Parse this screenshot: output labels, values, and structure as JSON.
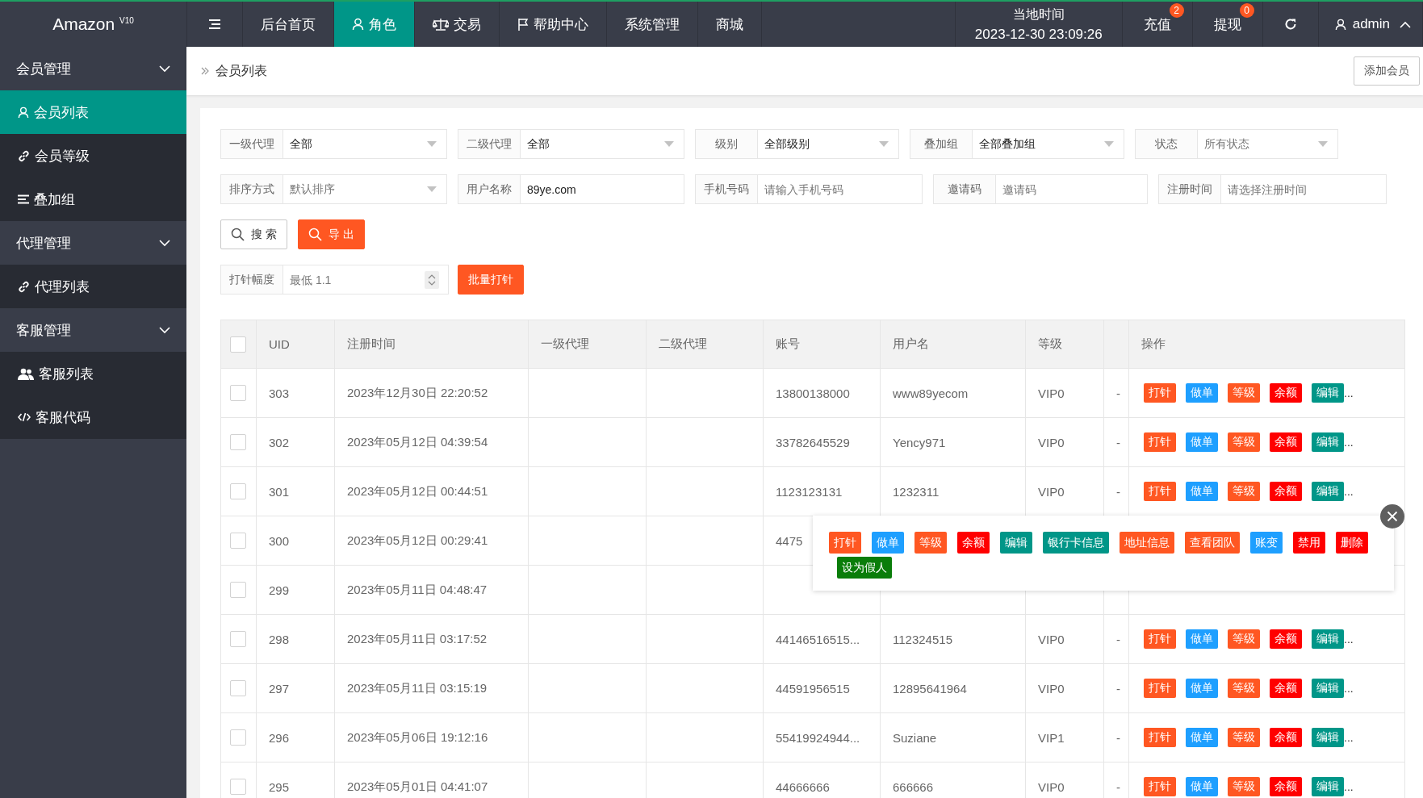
{
  "header": {
    "logo": "Amazon $^{V10}$",
    "nav": [
      {
        "label": "后台首页",
        "selected": false
      },
      {
        "label": "角色",
        "selected": true
      },
      {
        "label": "交易",
        "selected": false
      },
      {
        "label": "帮助中心",
        "selected": false
      },
      {
        "label": "系统管理",
        "selected": false
      },
      {
        "label": "商城",
        "selected": false
      }
    ],
    "clock": {
      "label": "当地时间",
      "value": "2023-12-30 23:09:26"
    },
    "quick": [
      {
        "label": "充值",
        "badge": "2"
      },
      {
        "label": "提现",
        "badge": "0"
      }
    ],
    "user": "admin"
  },
  "sidebar": [
    {
      "label": "会员管理",
      "expanded": true,
      "children": [
        {
          "label": "会员列表",
          "selected": true
        },
        {
          "label": "会员等级",
          "selected": false
        },
        {
          "label": "叠加组",
          "selected": false
        }
      ]
    },
    {
      "label": "代理管理",
      "expanded": true,
      "children": [
        {
          "label": "代理列表",
          "selected": false
        }
      ]
    },
    {
      "label": "客服管理",
      "expanded": true,
      "children": [
        {
          "label": "客服列表",
          "selected": false
        },
        {
          "label": "客服代码",
          "selected": false
        }
      ]
    }
  ],
  "breadcrumb": {
    "current": "会员列表",
    "add_button": "添加会员"
  },
  "filters": [
    [
      {
        "kind": "select",
        "label": "一级代理",
        "value": "全部"
      },
      {
        "kind": "select",
        "label": "二级代理",
        "value": "全部"
      },
      {
        "kind": "select",
        "label": "级别",
        "value": "全部级别"
      },
      {
        "kind": "select",
        "label": "叠加组",
        "value": "全部叠加组"
      },
      {
        "kind": "select",
        "label": "状态",
        "placeholder": "所有状态"
      }
    ],
    [
      {
        "kind": "select",
        "label": "排序方式",
        "placeholder": "默认排序"
      },
      {
        "kind": "text",
        "label": "用户名称",
        "value": "89ye.com"
      },
      {
        "kind": "text",
        "label": "手机号码",
        "placeholder": "请输入手机号码"
      },
      {
        "kind": "text",
        "label": "邀请码",
        "placeholder": "邀请码"
      },
      {
        "kind": "text",
        "label": "注册时间",
        "placeholder": "请选择注册时间"
      }
    ]
  ],
  "buttons": [
    {
      "label": "搜 索",
      "kind": "outline"
    },
    {
      "label": "导 出",
      "kind": "primary"
    }
  ],
  "dosage": {
    "label": "打针幅度",
    "placeholder": "最低 1.1",
    "button": "批量打针"
  },
  "table": {
    "all_checked": false,
    "columns": [
      {
        "label": "UID"
      },
      {
        "label": "注册时间"
      },
      {
        "label": "一级代理"
      },
      {
        "label": "二级代理"
      },
      {
        "label": "账号"
      },
      {
        "label": "用户名"
      },
      {
        "label": "等级"
      },
      {},
      {
        "label": "操作"
      }
    ],
    "rows": [
      {
        "checked": false,
        "uid": "303",
        "registered": "2023年12月30日 22:20:52",
        "account": "13800138000",
        "username": "www89yecom",
        "level": "VIP0",
        "column_9": "-",
        "actions": [
          {
            "label": "打针",
            "color": "#ff5722"
          },
          {
            "label": "做单",
            "color": "#1e9fff"
          },
          {
            "label": "等级",
            "color": "#ff5722"
          },
          {
            "label": "余额",
            "color": "#ff0000"
          },
          {
            "label": "编辑",
            "color": "#009688"
          }
        ],
        "more": "..."
      },
      {
        "checked": false,
        "uid": "302",
        "registered": "2023年05月12日 04:39:54",
        "account": "33782645529",
        "username": "Yency971",
        "level": "VIP0",
        "column_9": "-",
        "actions": [
          {
            "label": "打针",
            "color": "#ff5722"
          },
          {
            "label": "做单",
            "color": "#1e9fff"
          },
          {
            "label": "等级",
            "color": "#ff5722"
          },
          {
            "label": "余额",
            "color": "#ff0000"
          },
          {
            "label": "编辑",
            "color": "#009688"
          }
        ],
        "more": "..."
      },
      {
        "checked": false,
        "uid": "301",
        "registered": "2023年05月12日 00:44:51",
        "account": "1123123131",
        "username": "1232311",
        "level": "VIP0",
        "column_9": "-",
        "actions": [
          {
            "label": "打针",
            "color": "#ff5722"
          },
          {
            "label": "做单",
            "color": "#1e9fff"
          },
          {
            "label": "等级",
            "color": "#ff5722"
          },
          {
            "label": "余额",
            "color": "#ff0000"
          },
          {
            "label": "编辑",
            "color": "#009688"
          }
        ],
        "more": "..."
      },
      {
        "checked": false,
        "uid": "300",
        "registered": "2023年05月12日 00:29:41",
        "account": "4475"
      },
      {
        "checked": false,
        "uid": "299",
        "registered": "2023年05月11日 04:48:47"
      },
      {
        "checked": false,
        "uid": "298",
        "registered": "2023年05月11日 03:17:52",
        "account": "44146516515...",
        "username": "112324515",
        "level": "VIP0",
        "column_9": "-",
        "actions": [
          {
            "label": "打针",
            "color": "#ff5722"
          },
          {
            "label": "做单",
            "color": "#1e9fff"
          },
          {
            "label": "等级",
            "color": "#ff5722"
          },
          {
            "label": "余额",
            "color": "#ff0000"
          },
          {
            "label": "编辑",
            "color": "#009688"
          }
        ],
        "more": "..."
      },
      {
        "checked": false,
        "uid": "297",
        "registered": "2023年05月11日 03:15:19",
        "account": "44591956515",
        "username": "12895641964",
        "level": "VIP0",
        "column_9": "-",
        "actions": [
          {
            "label": "打针",
            "color": "#ff5722"
          },
          {
            "label": "做单",
            "color": "#1e9fff"
          },
          {
            "label": "等级",
            "color": "#ff5722"
          },
          {
            "label": "余额",
            "color": "#ff0000"
          },
          {
            "label": "编辑",
            "color": "#009688"
          }
        ],
        "more": "..."
      },
      {
        "checked": false,
        "uid": "296",
        "registered": "2023年05月06日 19:12:16",
        "account": "55419924944...",
        "username": "Suziane",
        "level": "VIP1",
        "column_9": "-",
        "actions": [
          {
            "label": "打针",
            "color": "#ff5722"
          },
          {
            "label": "做单",
            "color": "#1e9fff"
          },
          {
            "label": "等级",
            "color": "#ff5722"
          },
          {
            "label": "余额",
            "color": "#ff0000"
          },
          {
            "label": "编辑",
            "color": "#009688"
          }
        ],
        "more": "..."
      },
      {
        "checked": false,
        "uid": "295",
        "registered": "2023年05月01日 04:41:07",
        "account": "44666666",
        "username": "666666",
        "level": "VIP0",
        "column_9": "-",
        "actions": [
          {
            "label": "打针",
            "color": "#ff5722"
          },
          {
            "label": "做单",
            "color": "#1e9fff"
          },
          {
            "label": "等级",
            "color": "#ff5722"
          },
          {
            "label": "余额",
            "color": "#ff0000"
          },
          {
            "label": "编辑",
            "color": "#009688"
          }
        ],
        "more": "..."
      }
    ],
    "popup": {
      "actions": [
        {
          "label": "打针",
          "color": "#ff5722"
        },
        {
          "label": "做单",
          "color": "#1e9fff"
        },
        {
          "label": "等级",
          "color": "#ff5722"
        },
        {
          "label": "余额",
          "color": "#ff0000"
        },
        {
          "label": "编辑",
          "color": "#009688"
        },
        {
          "label": "银行卡信息",
          "color": "#009688"
        },
        {
          "label": "地址信息",
          "color": "#ff5722"
        },
        {
          "label": "查看团队",
          "color": "#ff5722"
        },
        {
          "label": "账变",
          "color": "#1e9fff"
        },
        {
          "label": "禁用",
          "color": "#ff0000"
        },
        {
          "label": "删除",
          "color": "#ff0000"
        },
        {
          "label": "设为假人",
          "color": "#0a7d0a"
        }
      ]
    }
  }
}
